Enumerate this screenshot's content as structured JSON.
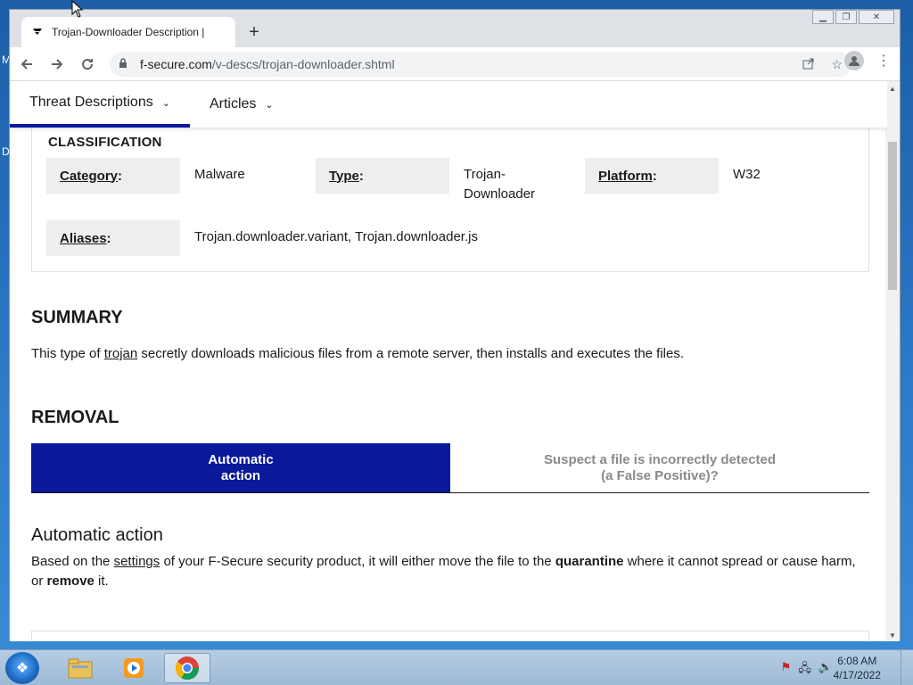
{
  "desktop": {
    "left_letters": [
      "M",
      "D"
    ]
  },
  "browser": {
    "tab_title": "Trojan-Downloader Description |",
    "url_host": "f-secure.com",
    "url_path": "/v-descs/trojan-downloader.shtml"
  },
  "site_nav": {
    "items": [
      {
        "label": "Threat Descriptions",
        "active": true
      },
      {
        "label": "Articles",
        "active": false
      }
    ]
  },
  "classification": {
    "title": "CLASSIFICATION",
    "category_label": "Category",
    "category_value": "Malware",
    "type_label": "Type",
    "type_value_line1": "Trojan-",
    "type_value_line2": "Downloader",
    "platform_label": "Platform",
    "platform_value": "W32",
    "aliases_label": "Aliases",
    "aliases_value": "Trojan.downloader.variant, Trojan.downloader.js"
  },
  "summary": {
    "title": "SUMMARY",
    "text_before": "This type of ",
    "link": "trojan",
    "text_after": " secretly downloads malicious files from a remote server, then installs and executes the files."
  },
  "removal": {
    "title": "REMOVAL",
    "tab_automatic_line1": "Automatic",
    "tab_automatic_line2": "action",
    "tab_false_positive_line1": "Suspect a file is incorrectly detected",
    "tab_false_positive_line2": "(a False Positive)?",
    "section_title": "Automatic action",
    "p1": "Based on the ",
    "p_link": "settings",
    "p2": " of your F-Secure security product, it will either move the file to the ",
    "p_bold1": "quarantine",
    "p3": " where it cannot spread or cause harm,",
    "p4": "or ",
    "p_bold2": "remove",
    "p5": " it."
  },
  "taskbar": {
    "time": "6:08 AM",
    "date": "4/17/2022"
  },
  "colors": {
    "accent": "#0a189a",
    "label_bg": "#eeeeee"
  }
}
